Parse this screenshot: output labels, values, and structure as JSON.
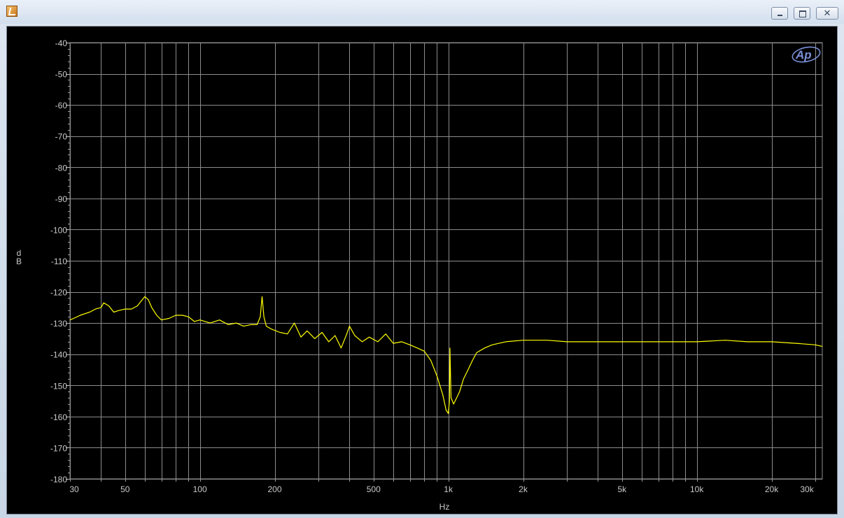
{
  "window": {
    "title": ""
  },
  "colors": {
    "background": "#000000",
    "grid": "#8c8c8c",
    "trace": "#ffff00",
    "text": "#c9c9c9",
    "logo": "#7a8fd6"
  },
  "logo": {
    "text": "Ap"
  },
  "chart_data": {
    "type": "line",
    "title": "",
    "xlabel": "Hz",
    "ylabel": "dB",
    "xscale": "log",
    "xlim": [
      30,
      32000
    ],
    "ylim": [
      -180,
      -40
    ],
    "grid": true,
    "x_ticks": [
      30,
      50,
      100,
      200,
      500,
      1000,
      2000,
      5000,
      10000,
      20000,
      30000
    ],
    "x_tick_labels": [
      "30",
      "50",
      "100",
      "200",
      "500",
      "1k",
      "2k",
      "5k",
      "10k",
      "20k",
      "30k"
    ],
    "y_ticks": [
      -40,
      -50,
      -60,
      -70,
      -80,
      -90,
      -100,
      -110,
      -120,
      -130,
      -140,
      -150,
      -160,
      -170,
      -180
    ],
    "y_tick_labels": [
      "-40",
      "-50",
      "-60",
      "-70",
      "-80",
      "-90",
      "-100",
      "-110",
      "-120",
      "-130",
      "-140",
      "-150",
      "-160",
      "-170",
      "-180"
    ],
    "series": [
      {
        "color": "#ffff00",
        "points": [
          [
            30,
            -129
          ],
          [
            31,
            -128.5
          ],
          [
            33,
            -127.5
          ],
          [
            36,
            -126.5
          ],
          [
            38,
            -125.5
          ],
          [
            40,
            -125
          ],
          [
            41,
            -123.5
          ],
          [
            43,
            -124.5
          ],
          [
            45,
            -126.5
          ],
          [
            47,
            -126
          ],
          [
            50,
            -125.5
          ],
          [
            53,
            -125.5
          ],
          [
            56,
            -124.5
          ],
          [
            58,
            -123
          ],
          [
            60,
            -121.5
          ],
          [
            62,
            -122.5
          ],
          [
            64,
            -125
          ],
          [
            67,
            -127.5
          ],
          [
            70,
            -129
          ],
          [
            75,
            -128.5
          ],
          [
            80,
            -127.5
          ],
          [
            85,
            -127.5
          ],
          [
            90,
            -128
          ],
          [
            95,
            -129.5
          ],
          [
            100,
            -129
          ],
          [
            110,
            -130
          ],
          [
            120,
            -129
          ],
          [
            130,
            -130.5
          ],
          [
            140,
            -130
          ],
          [
            150,
            -131
          ],
          [
            160,
            -130.5
          ],
          [
            170,
            -130.5
          ],
          [
            175,
            -128
          ],
          [
            178,
            -121.5
          ],
          [
            181,
            -128
          ],
          [
            185,
            -131
          ],
          [
            195,
            -132
          ],
          [
            210,
            -133
          ],
          [
            225,
            -133.5
          ],
          [
            240,
            -130
          ],
          [
            255,
            -134.5
          ],
          [
            270,
            -132.5
          ],
          [
            290,
            -135
          ],
          [
            310,
            -133
          ],
          [
            330,
            -136
          ],
          [
            350,
            -134
          ],
          [
            370,
            -138
          ],
          [
            390,
            -133.5
          ],
          [
            400,
            -131
          ],
          [
            420,
            -134
          ],
          [
            450,
            -136
          ],
          [
            480,
            -134.5
          ],
          [
            520,
            -136
          ],
          [
            560,
            -133.5
          ],
          [
            600,
            -136.5
          ],
          [
            650,
            -136
          ],
          [
            700,
            -137
          ],
          [
            750,
            -138
          ],
          [
            800,
            -139
          ],
          [
            850,
            -142
          ],
          [
            900,
            -147
          ],
          [
            950,
            -153
          ],
          [
            980,
            -158
          ],
          [
            1000,
            -159
          ],
          [
            1010,
            -155
          ],
          [
            1015,
            -138
          ],
          [
            1025,
            -154
          ],
          [
            1050,
            -156
          ],
          [
            1080,
            -154
          ],
          [
            1110,
            -152
          ],
          [
            1150,
            -148
          ],
          [
            1200,
            -145
          ],
          [
            1250,
            -142
          ],
          [
            1300,
            -139.5
          ],
          [
            1400,
            -138
          ],
          [
            1500,
            -137
          ],
          [
            1700,
            -136
          ],
          [
            2000,
            -135.5
          ],
          [
            2500,
            -135.5
          ],
          [
            3000,
            -136
          ],
          [
            4000,
            -136
          ],
          [
            5000,
            -136
          ],
          [
            6000,
            -136
          ],
          [
            8000,
            -136
          ],
          [
            10000,
            -136
          ],
          [
            13000,
            -135.5
          ],
          [
            16000,
            -136
          ],
          [
            20000,
            -136
          ],
          [
            25000,
            -136.5
          ],
          [
            30000,
            -137
          ],
          [
            32000,
            -137.5
          ]
        ]
      }
    ]
  }
}
